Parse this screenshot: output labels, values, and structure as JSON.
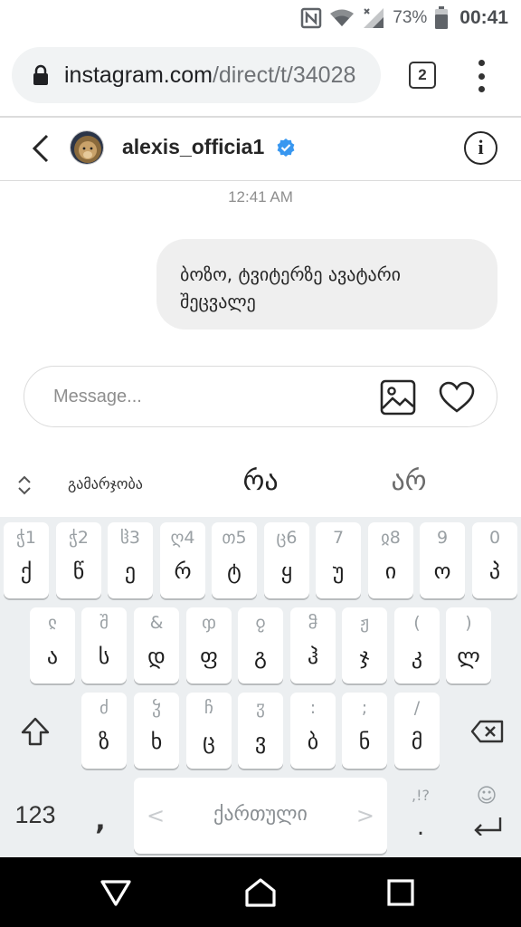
{
  "status_bar": {
    "battery_percent": "73%",
    "time": "00:41"
  },
  "browser": {
    "url_host": "instagram.com",
    "url_path": "/direct/t/34028",
    "tab_count": "2"
  },
  "chat": {
    "username": "alexis_officia1",
    "info_label": "i",
    "timestamp": "12:41 AM",
    "messages": [
      {
        "line1": "ბოზო, ტვიტერზე ავატარი",
        "line2": "შეცვალე",
        "sender": "me"
      }
    ],
    "composer_placeholder": "Message..."
  },
  "keyboard": {
    "suggestions": {
      "left": "გამარჯობა",
      "center": "რა",
      "right": "არ"
    },
    "row1": [
      {
        "hint": "ჭ1",
        "main": "ქ"
      },
      {
        "hint": "ჭ2",
        "main": "წ"
      },
      {
        "hint": "ჱ3",
        "main": "ე"
      },
      {
        "hint": "ღ4",
        "main": "რ"
      },
      {
        "hint": "თ5",
        "main": "ტ"
      },
      {
        "hint": "ც6",
        "main": "ყ"
      },
      {
        "hint": "7",
        "main": "უ"
      },
      {
        "hint": "ჲ8",
        "main": "ი"
      },
      {
        "hint": "9",
        "main": "ო"
      },
      {
        "hint": "0",
        "main": "პ"
      }
    ],
    "row2": [
      {
        "hint": "ჺ",
        "main": "ა"
      },
      {
        "hint": "შ",
        "main": "ს"
      },
      {
        "hint": "&",
        "main": "დ"
      },
      {
        "hint": "ჶ",
        "main": "ფ"
      },
      {
        "hint": "ჹ",
        "main": "გ"
      },
      {
        "hint": "ჵ",
        "main": "ჰ"
      },
      {
        "hint": "ჟ",
        "main": "ჯ"
      },
      {
        "hint": "(",
        "main": "კ"
      },
      {
        "hint": ")",
        "main": "ლ"
      }
    ],
    "row3": [
      {
        "hint": "ძ",
        "main": "ზ"
      },
      {
        "hint": "ჴ",
        "main": "ხ"
      },
      {
        "hint": "ჩ",
        "main": "ც"
      },
      {
        "hint": "ჳ",
        "main": "ვ"
      },
      {
        "hint": ":",
        "main": "ბ"
      },
      {
        "hint": ";",
        "main": "ნ"
      },
      {
        "hint": "/",
        "main": "მ"
      }
    ],
    "symbols_key": "123",
    "comma_key": ",",
    "space_label": "ქართული",
    "space_left_arrow": "<",
    "space_right_arrow": ">",
    "period_hint": ",!?",
    "period_key": ".",
    "emoji_hint": "☺"
  }
}
